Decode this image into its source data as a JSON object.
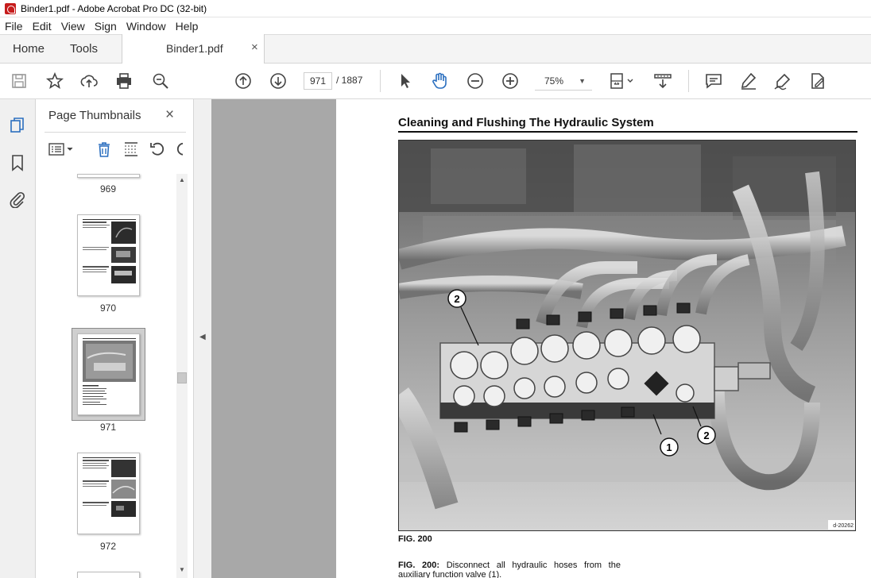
{
  "window": {
    "title": "Binder1.pdf - Adobe Acrobat Pro DC (32-bit)"
  },
  "menu": [
    "File",
    "Edit",
    "View",
    "Sign",
    "Window",
    "Help"
  ],
  "tabs": {
    "home": "Home",
    "tools": "Tools",
    "document": "Binder1.pdf",
    "close": "×"
  },
  "toolbar": {
    "current_page": "971",
    "total_pages": "/ 1887",
    "zoom": "75%"
  },
  "thumbnails": {
    "title": "Page Thumbnails",
    "close": "×",
    "pages": [
      "969",
      "970",
      "971",
      "972"
    ],
    "selected_page": "971"
  },
  "document": {
    "heading": "Cleaning and Flushing The Hydraulic System",
    "figure_code": "d-20262",
    "callouts": [
      "2",
      "1",
      "2"
    ],
    "figure_label": "FIG. 200",
    "caption_bold": "FIG. 200:",
    "caption_text": " Disconnect all hydraulic hoses from the auxiliary function valve (1)."
  },
  "colors": {
    "accent": "#2b6fbf",
    "pdf_red": "#c61c1c",
    "doc_bg": "#a8a8a8"
  }
}
